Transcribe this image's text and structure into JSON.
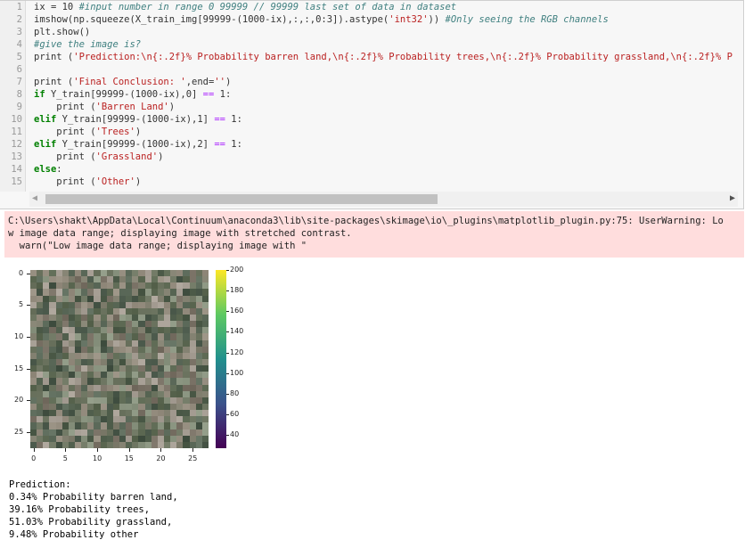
{
  "code_lines": [
    {
      "n": "1",
      "html": "ix = 10 <span class='cm'>#input number in range 0 99999 // 99999 last set of data in dataset</span>"
    },
    {
      "n": "2",
      "html": "imshow(np.squeeze(X_train_img[99999-(1000-ix),:,:,0:3]).astype(<span class='st'>'int32'</span>)) <span class='cm'>#Only seeing the RGB channels</span>"
    },
    {
      "n": "3",
      "html": "plt.show()"
    },
    {
      "n": "4",
      "html": "<span class='cm'>#give the image is?</span>"
    },
    {
      "n": "5",
      "html": "print (<span class='st'>'Prediction:\\n{:.2f}% Probability barren land,\\n{:.2f}% Probability trees,\\n{:.2f}% Probability grassland,\\n{:.2f}% P</span>"
    },
    {
      "n": "6",
      "html": ""
    },
    {
      "n": "7",
      "html": "print (<span class='st'>'Final Conclusion: '</span>,end=<span class='st'>''</span>)"
    },
    {
      "n": "8",
      "html": "<span class='kw'>if</span> Y_train[99999-(1000-ix),0] <span class='op'>==</span> 1:"
    },
    {
      "n": "9",
      "html": "    print (<span class='st'>'Barren Land'</span>)"
    },
    {
      "n": "10",
      "html": "<span class='kw'>elif</span> Y_train[99999-(1000-ix),1] <span class='op'>==</span> 1:"
    },
    {
      "n": "11",
      "html": "    print (<span class='st'>'Trees'</span>)"
    },
    {
      "n": "12",
      "html": "<span class='kw'>elif</span> Y_train[99999-(1000-ix),2] <span class='op'>==</span> 1:"
    },
    {
      "n": "13",
      "html": "    print (<span class='st'>'Grassland'</span>)"
    },
    {
      "n": "14",
      "html": "<span class='kw'>else</span>:"
    },
    {
      "n": "15",
      "html": "    print (<span class='st'>'Other'</span>)"
    }
  ],
  "stderr": {
    "line1": "C:\\Users\\shakt\\AppData\\Local\\Continuum\\anaconda3\\lib\\site-packages\\skimage\\io\\_plugins\\matplotlib_plugin.py:75: UserWarning: Lo",
    "line2": "w image data range; displaying image with stretched contrast.",
    "line3": "  warn(\"Low image data range; displaying image with \""
  },
  "plot": {
    "y_ticks": [
      "0",
      "5",
      "10",
      "15",
      "20",
      "25"
    ],
    "x_ticks": [
      "0",
      "5",
      "10",
      "15",
      "20",
      "25"
    ],
    "colorbar_ticks": [
      "200",
      "180",
      "160",
      "140",
      "120",
      "100",
      "80",
      "60",
      "40"
    ]
  },
  "output": {
    "line1": "Prediction:",
    "line2": "0.34% Probability barren land,",
    "line3": "39.16% Probability trees,",
    "line4": "51.03% Probability grassland,",
    "line5": "9.48% Probability other"
  }
}
